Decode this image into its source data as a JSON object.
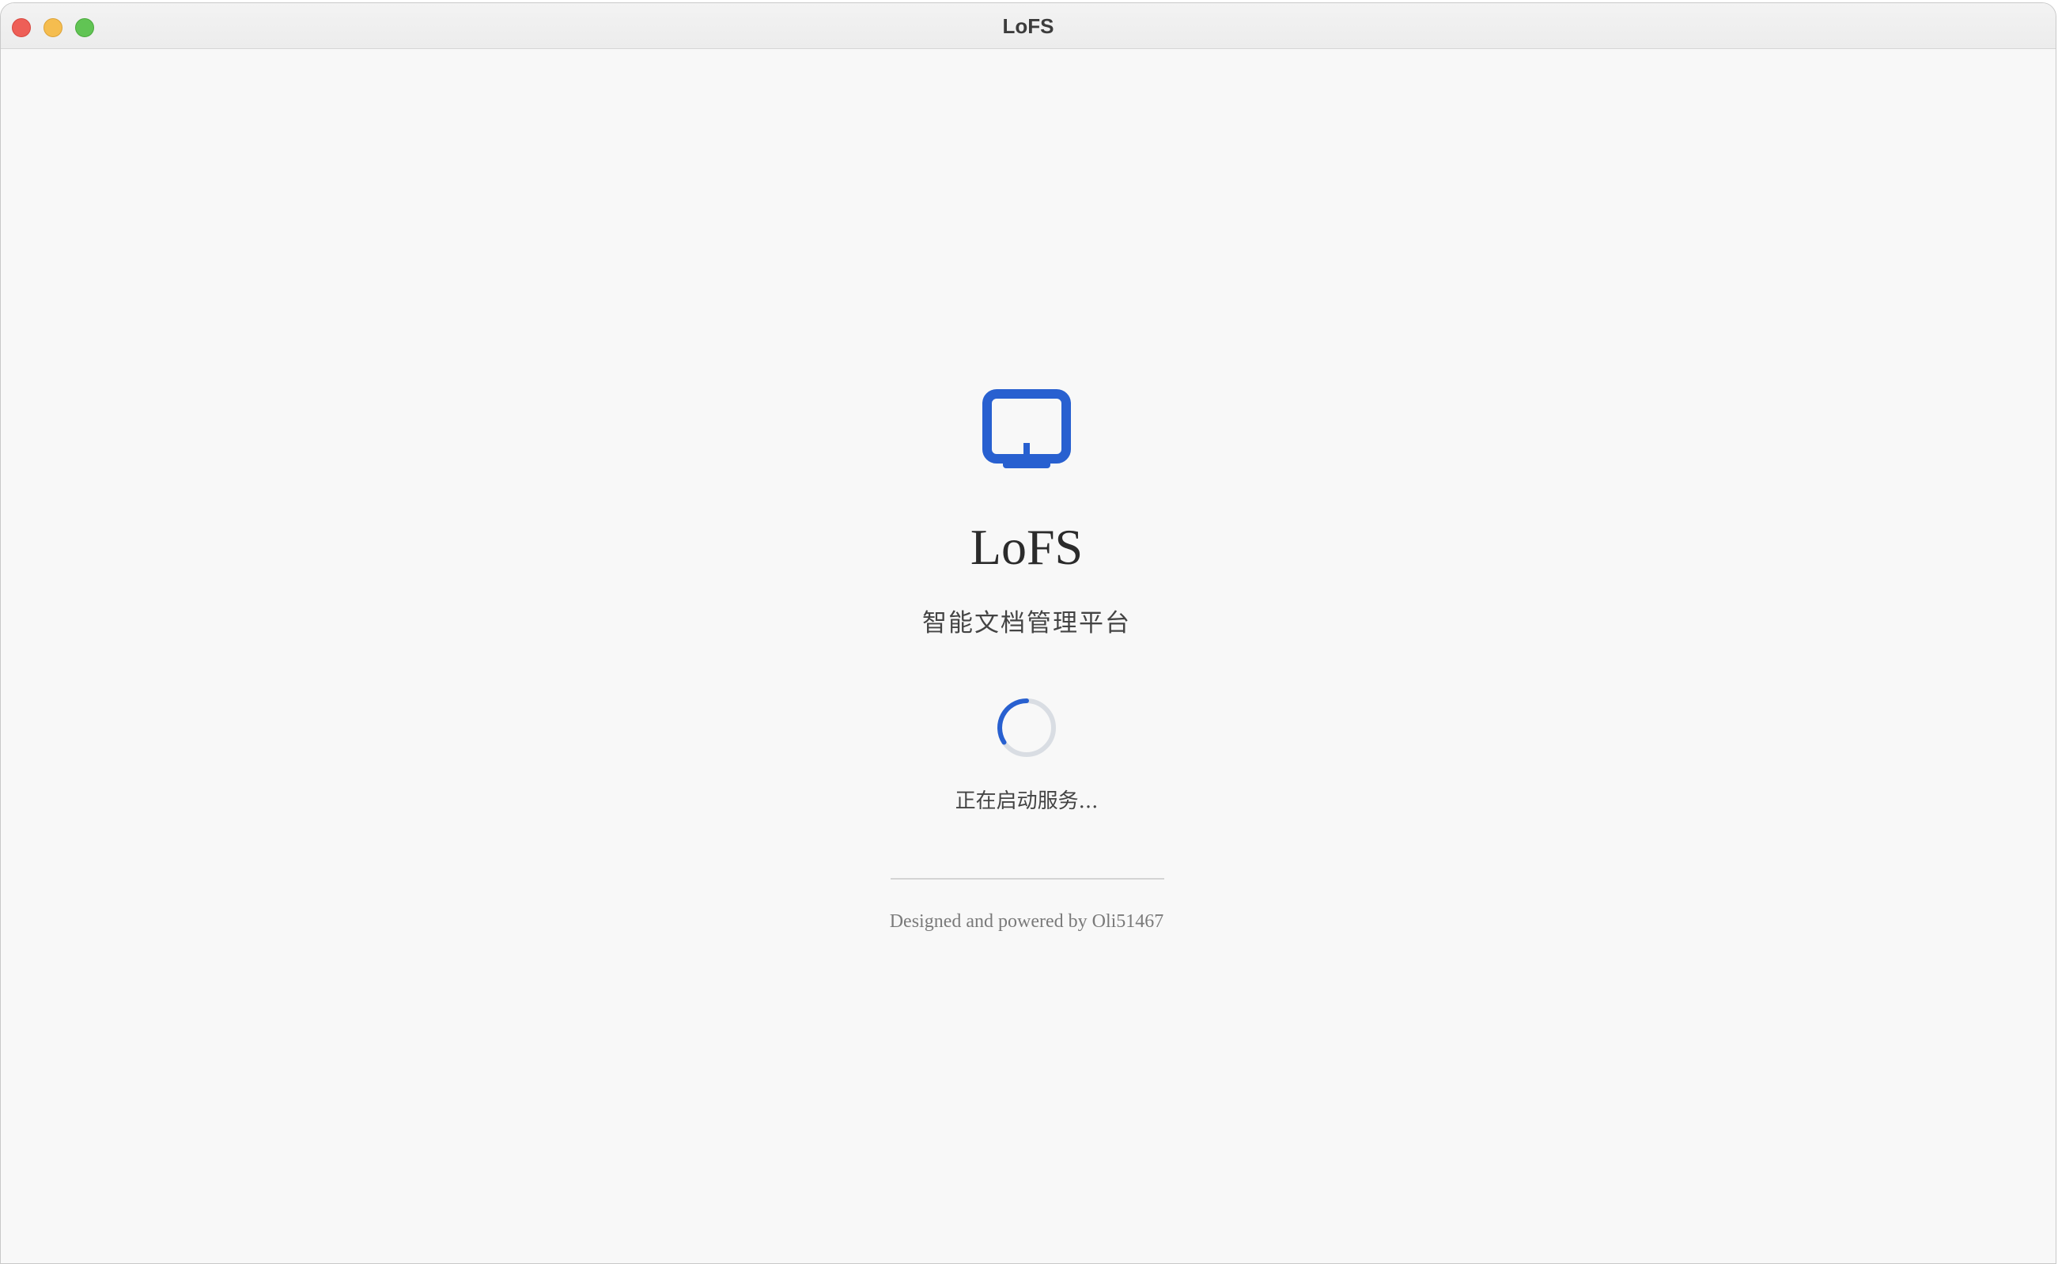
{
  "window": {
    "title": "LoFS",
    "controls": {
      "close": "close-icon",
      "minimize": "minimize-icon",
      "zoom": "zoom-icon"
    }
  },
  "splash": {
    "logo_icon": "monitor-icon",
    "app_name": "LoFS",
    "subtitle": "智能文档管理平台",
    "spinner_icon": "loading-spinner-icon",
    "status": "正在启动服务...",
    "credit": "Designed and powered by Oli51467"
  },
  "colors": {
    "accent": "#2860d0",
    "spinner_track": "#d9dde3",
    "background": "#f8f8f8",
    "close": "#ee5f57",
    "minimize": "#f5bd4f",
    "zoom": "#61c454"
  }
}
